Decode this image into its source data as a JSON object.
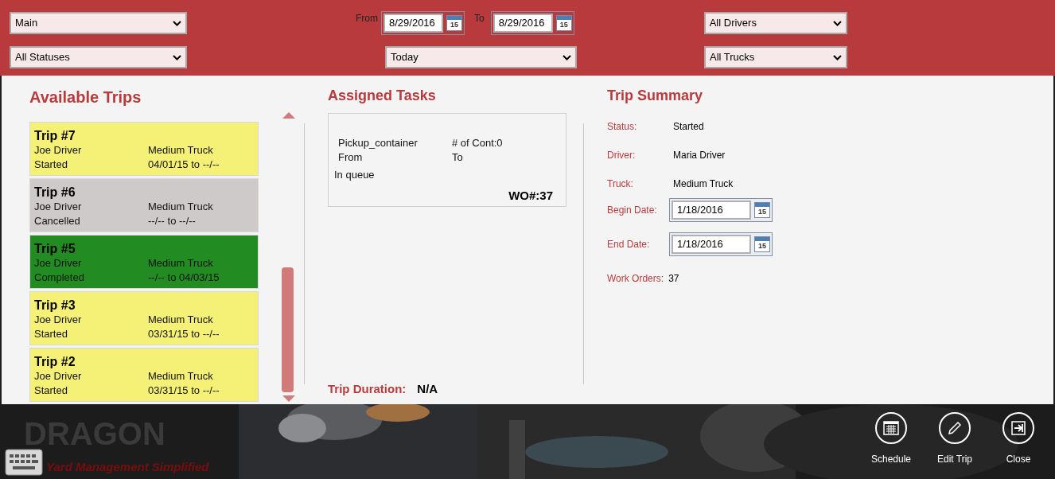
{
  "filters": {
    "view": "Main",
    "from_label": "From",
    "from_date": "8/29/2016",
    "from_calendar_day": "15",
    "to_label": "To",
    "to_date": "8/29/2016",
    "to_calendar_day": "15",
    "drivers": "All Drivers",
    "statuses": "All Statuses",
    "range": "Today",
    "trucks": "All Trucks"
  },
  "available_trips": {
    "title": "Available Trips",
    "trips": [
      {
        "title": "Trip #7",
        "driver": "Joe Driver",
        "truck": "Medium Truck",
        "status": "Started",
        "dates": "04/01/15 to --/--",
        "color": "#f5f076"
      },
      {
        "title": "Trip #6",
        "driver": "Joe Driver",
        "truck": "Medium Truck",
        "status": "Cancelled",
        "dates": "--/-- to --/--",
        "color": "#cfcaca"
      },
      {
        "title": "Trip #5",
        "driver": "Joe Driver",
        "truck": "Medium Truck",
        "status": "Completed",
        "dates": "--/-- to 04/03/15",
        "color": "#228b22"
      },
      {
        "title": "Trip #3",
        "driver": "Joe Driver",
        "truck": "Medium Truck",
        "status": "Started",
        "dates": "03/31/15 to --/--",
        "color": "#f5f076"
      },
      {
        "title": "Trip #2",
        "driver": "Joe Driver",
        "truck": "Medium Truck",
        "status": "Started",
        "dates": "03/31/15 to --/--",
        "color": "#f5f076"
      }
    ]
  },
  "assigned_tasks": {
    "title": "Assigned Tasks",
    "tasks": [
      {
        "type": "Pickup_container",
        "count": "# of Cont:0",
        "from": "From",
        "to": "To",
        "state": "In queue",
        "wo": "WO#:37"
      }
    ],
    "duration_label": "Trip Duration:",
    "duration": "N/A"
  },
  "trip_summary": {
    "title": "Trip Summary",
    "status_label": "Status:",
    "status": "Started",
    "driver_label": "Driver:",
    "driver": "Maria Driver",
    "truck_label": "Truck:",
    "truck": "Medium Truck",
    "begin_label": "Begin Date:",
    "begin": "1/18/2016",
    "begin_calendar_day": "15",
    "end_label": "End Date:",
    "end": "1/18/2016",
    "end_calendar_day": "15",
    "wo_label": "Work Orders:",
    "wo": "37"
  },
  "logo": {
    "name": "DRAGON",
    "tagline": "Yard Management Simplified"
  },
  "app_bar": [
    {
      "kind": "schedule",
      "label": "Schedule"
    },
    {
      "kind": "edit",
      "label": "Edit Trip"
    },
    {
      "kind": "close",
      "label": "Close"
    }
  ]
}
